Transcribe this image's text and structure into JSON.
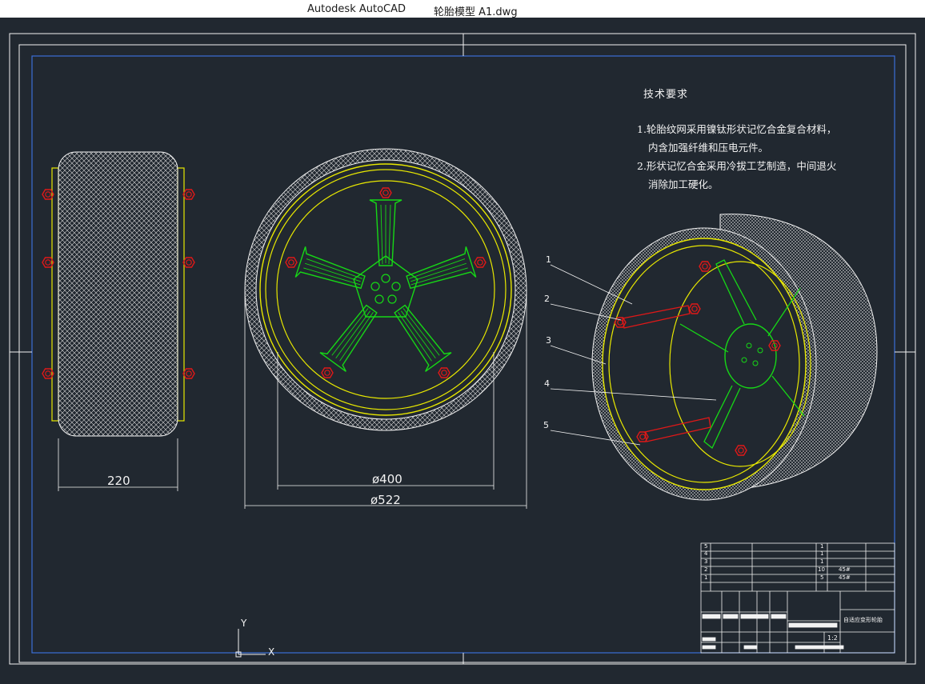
{
  "window": {
    "app_name": "Autodesk AutoCAD",
    "document_name": "轮胎模型 A1.dwg"
  },
  "technical_requirements": {
    "title": "技术要求",
    "lines": [
      "1.轮胎纹网采用镍钛形状记忆合金复合材料，",
      "内含加强纤维和压电元件。",
      "2.形状记忆合金采用冷拔工艺制造，中间退火",
      "消除加工硬化。"
    ]
  },
  "dimensions": {
    "width": "220",
    "rim_diameter": "ø400",
    "tire_diameter": "ø522"
  },
  "part_callouts": [
    "1",
    "2",
    "3",
    "4",
    "5"
  ],
  "title_block": {
    "rows": [
      {
        "no": "5",
        "qty": "1",
        "material": ""
      },
      {
        "no": "4",
        "qty": "1",
        "material": ""
      },
      {
        "no": "3",
        "qty": "1",
        "material": ""
      },
      {
        "no": "2",
        "qty": "10",
        "material": "45#"
      },
      {
        "no": "1",
        "qty": "5",
        "material": "45#"
      }
    ],
    "drawing_name": "自适应变形轮胎",
    "scale": "1:2"
  },
  "ucs": {
    "x_label": "X",
    "y_label": "Y"
  },
  "colors": {
    "background": "#212830",
    "rim": "#e8e800",
    "spokes": "#16d816",
    "bolts": "#e01818",
    "lines": "#f2f2f2",
    "viewport": "#3a6fd8"
  }
}
